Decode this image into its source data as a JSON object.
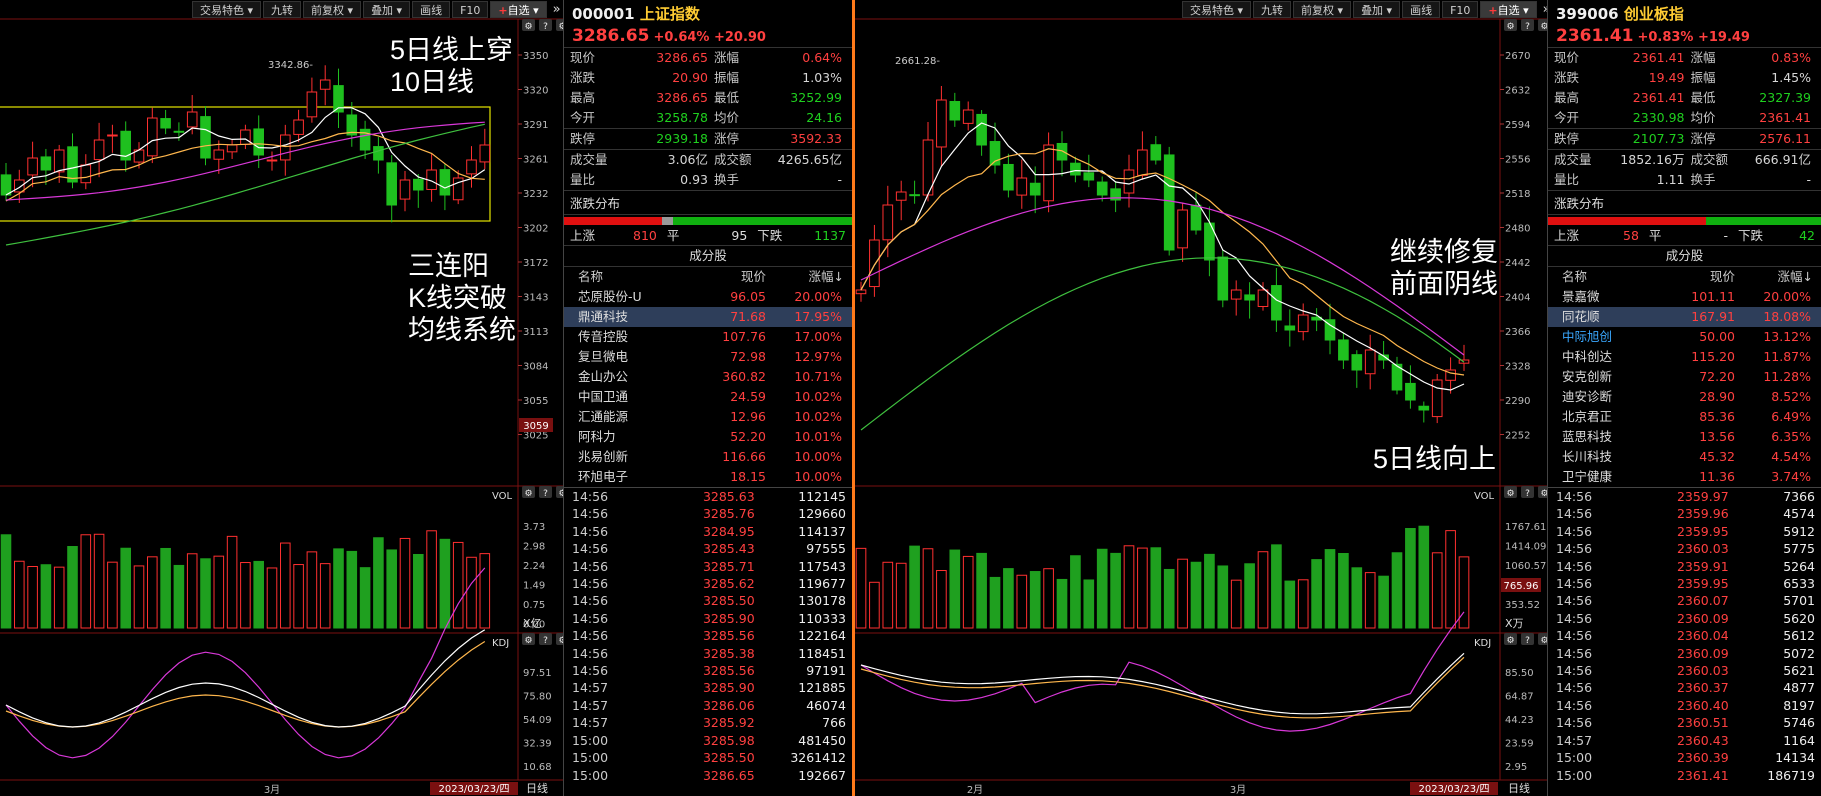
{
  "toolbar": {
    "btn1": "交易特色",
    "btn2": "九转",
    "btn3": "前复权",
    "btn4": "叠加",
    "btn5": "画线",
    "btn6": "F10",
    "btn7": "自选",
    "more": "»"
  },
  "left_chart": {
    "y_labels": [
      "3350",
      "3320",
      "3291",
      "3261",
      "3232",
      "3202",
      "3172",
      "3143",
      "3113",
      "3084",
      "3055",
      "3025"
    ],
    "high_label": "3342.86",
    "price_tag": "3059",
    "vol_title": "VOL",
    "vol_labels": [
      "3.73",
      "2.98",
      "2.24",
      "1.49",
      "0.75",
      "0.00"
    ],
    "vol_unit": "X亿",
    "kdj_title": "KDJ",
    "kdj_labels": [
      "97.51",
      "75.80",
      "54.09",
      "32.39",
      "10.68"
    ],
    "month": "3月",
    "date_box": "2023/03/23/四",
    "period": "日线",
    "ann1a": "5日线上穿",
    "ann1b": "10日线",
    "ann2a": "三连阳",
    "ann2b": "K线突破",
    "ann2c": "均线系统"
  },
  "left_info": {
    "code": "000001",
    "name": "上证指数",
    "price": "3286.65",
    "change": "+0.64% +20.90",
    "rows": [
      [
        "现价",
        "3286.65",
        "red",
        "涨幅",
        "0.64%",
        "red"
      ],
      [
        "涨跌",
        "20.90",
        "red",
        "振幅",
        "1.03%",
        "wht"
      ],
      [
        "最高",
        "3286.65",
        "red",
        "最低",
        "3252.99",
        "grn"
      ],
      [
        "今开",
        "3258.78",
        "grn",
        "均价",
        "24.16",
        "grn"
      ],
      [
        "跌停",
        "2939.18",
        "grn",
        "涨停",
        "3592.33",
        "red"
      ],
      [
        "成交量",
        "3.06亿",
        "wht",
        "成交额",
        "4265.65亿",
        "wht"
      ],
      [
        "量比",
        "0.93",
        "wht",
        "换手",
        "-",
        "wht"
      ]
    ],
    "dist_title": "涨跌分布",
    "dist_up_label": "上涨",
    "dist_up": "810",
    "dist_flat_label": "平",
    "dist_flat": "95",
    "dist_down_label": "下跌",
    "dist_down": "1137",
    "cons_title": "成分股",
    "cons_head": [
      "名称",
      "现价",
      "涨幅↓"
    ],
    "cons": [
      [
        "芯原股份-U",
        "96.05",
        "20.00%"
      ],
      [
        "鼎通科技",
        "71.68",
        "17.95%"
      ],
      [
        "传音控股",
        "107.76",
        "17.00%"
      ],
      [
        "复旦微电",
        "72.98",
        "12.97%"
      ],
      [
        "金山办公",
        "360.82",
        "10.71%"
      ],
      [
        "中国卫通",
        "24.59",
        "10.02%"
      ],
      [
        "汇通能源",
        "12.96",
        "10.02%"
      ],
      [
        "阿科力",
        "52.20",
        "10.01%"
      ],
      [
        "兆易创新",
        "116.66",
        "10.00%"
      ],
      [
        "环旭电子",
        "18.15",
        "10.00%"
      ]
    ],
    "ticks": [
      [
        "14:56",
        "3285.63",
        "112145"
      ],
      [
        "14:56",
        "3285.76",
        "129660"
      ],
      [
        "14:56",
        "3284.95",
        "114137"
      ],
      [
        "14:56",
        "3285.43",
        "97555"
      ],
      [
        "14:56",
        "3285.71",
        "117543"
      ],
      [
        "14:56",
        "3285.62",
        "119677"
      ],
      [
        "14:56",
        "3285.50",
        "130178"
      ],
      [
        "14:56",
        "3285.90",
        "110333"
      ],
      [
        "14:56",
        "3285.56",
        "122164"
      ],
      [
        "14:56",
        "3285.38",
        "118451"
      ],
      [
        "14:56",
        "3285.56",
        "97191"
      ],
      [
        "14:57",
        "3285.90",
        "121885"
      ],
      [
        "14:57",
        "3286.06",
        "46074"
      ],
      [
        "14:57",
        "3285.92",
        "766"
      ],
      [
        "15:00",
        "3285.98",
        "481450"
      ],
      [
        "15:00",
        "3285.50",
        "3261412"
      ],
      [
        "15:00",
        "3286.65",
        "192667"
      ]
    ]
  },
  "right_chart": {
    "y_labels": [
      "2670",
      "2632",
      "2594",
      "2556",
      "2518",
      "2480",
      "2442",
      "2404",
      "2366",
      "2328",
      "2290",
      "2252"
    ],
    "high_label": "2661.28",
    "vol_title": "VOL",
    "vol_labels": [
      "1767.61",
      "1414.09",
      "1060.57",
      "707.04",
      "353.52"
    ],
    "vol_tag": "765.96",
    "vol_unit": "X万",
    "kdj_title": "KDJ",
    "kdj_labels": [
      "85.50",
      "64.87",
      "44.23",
      "23.59",
      "2.95"
    ],
    "month1": "2月",
    "month2": "3月",
    "date_box": "2023/03/23/四",
    "period": "日线",
    "ann1a": "继续修复",
    "ann1b": "前面阴线",
    "ann2": "5日线向上"
  },
  "right_info": {
    "code": "399006",
    "name": "创业板指",
    "price": "2361.41",
    "change": "+0.83% +19.49",
    "rows": [
      [
        "现价",
        "2361.41",
        "red",
        "涨幅",
        "0.83%",
        "red"
      ],
      [
        "涨跌",
        "19.49",
        "red",
        "振幅",
        "1.45%",
        "wht"
      ],
      [
        "最高",
        "2361.41",
        "red",
        "最低",
        "2327.39",
        "grn"
      ],
      [
        "今开",
        "2330.98",
        "grn",
        "均价",
        "2361.41",
        "red"
      ],
      [
        "跌停",
        "2107.73",
        "grn",
        "涨停",
        "2576.11",
        "red"
      ],
      [
        "成交量",
        "1852.16万",
        "wht",
        "成交额",
        "666.91亿",
        "wht"
      ],
      [
        "量比",
        "1.11",
        "wht",
        "换手",
        "-",
        "wht"
      ]
    ],
    "dist_title": "涨跌分布",
    "dist_up_label": "上涨",
    "dist_up": "58",
    "dist_flat_label": "平",
    "dist_flat": "-",
    "dist_down_label": "下跌",
    "dist_down": "42",
    "cons_title": "成分股",
    "cons_head": [
      "名称",
      "现价",
      "涨幅↓"
    ],
    "cons": [
      [
        "景嘉微",
        "101.11",
        "20.00%"
      ],
      [
        "同花顺",
        "167.91",
        "18.08%"
      ],
      [
        "中际旭创",
        "50.00",
        "13.12%"
      ],
      [
        "中科创达",
        "115.20",
        "11.87%"
      ],
      [
        "安克创新",
        "72.20",
        "11.28%"
      ],
      [
        "迪安诊断",
        "28.90",
        "8.52%"
      ],
      [
        "北京君正",
        "85.36",
        "6.49%"
      ],
      [
        "蓝思科技",
        "13.56",
        "6.35%"
      ],
      [
        "长川科技",
        "45.32",
        "4.54%"
      ],
      [
        "卫宁健康",
        "11.36",
        "3.74%"
      ]
    ],
    "ticks": [
      [
        "14:56",
        "2359.97",
        "7366"
      ],
      [
        "14:56",
        "2359.96",
        "4574"
      ],
      [
        "14:56",
        "2359.95",
        "5912"
      ],
      [
        "14:56",
        "2360.03",
        "5775"
      ],
      [
        "14:56",
        "2359.91",
        "5264"
      ],
      [
        "14:56",
        "2359.95",
        "6533"
      ],
      [
        "14:56",
        "2360.07",
        "5701"
      ],
      [
        "14:56",
        "2360.09",
        "5620"
      ],
      [
        "14:56",
        "2360.04",
        "5612"
      ],
      [
        "14:56",
        "2360.09",
        "5072"
      ],
      [
        "14:56",
        "2360.03",
        "5621"
      ],
      [
        "14:56",
        "2360.37",
        "4877"
      ],
      [
        "14:56",
        "2360.40",
        "8197"
      ],
      [
        "14:56",
        "2360.51",
        "5746"
      ],
      [
        "14:57",
        "2360.43",
        "1164"
      ],
      [
        "15:00",
        "2360.39",
        "14134"
      ],
      [
        "15:00",
        "2361.41",
        "186719"
      ]
    ]
  },
  "chart_data": [
    {
      "type": "line",
      "title": "上证指数 日线 K线",
      "ylim": [
        3025,
        3350
      ],
      "series": [
        {
          "name": "MA5",
          "values": []
        },
        {
          "name": "MA10",
          "values": []
        }
      ],
      "high": 3342.86
    },
    {
      "type": "line",
      "title": "创业板指 日线 K线",
      "ylim": [
        2252,
        2670
      ],
      "high": 2661.28
    }
  ]
}
